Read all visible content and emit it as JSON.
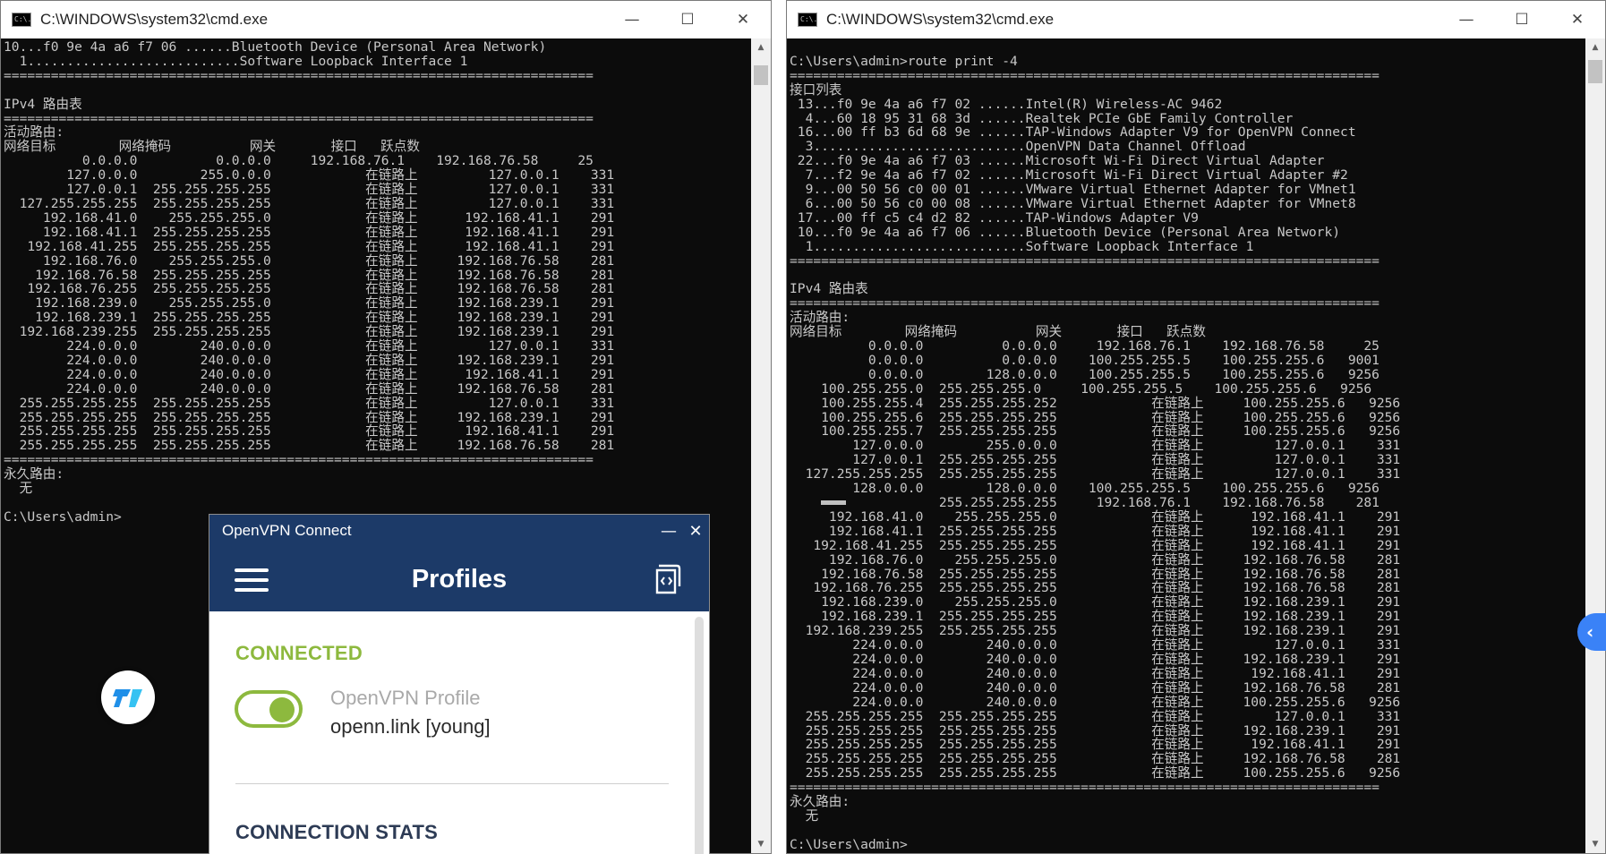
{
  "left_window": {
    "title": "C:\\WINDOWS\\system32\\cmd.exe",
    "icon": "C:\\.",
    "controls": {
      "minimize": "—",
      "maximize": "☐",
      "close": "✕"
    },
    "console_lines": [
      "10...f0 9e 4a a6 f7 06 ......Bluetooth Device (Personal Area Network)",
      "  1...........................Software Loopback Interface 1",
      "===========================================================================",
      "",
      "IPv4 路由表",
      "===========================================================================",
      "活动路由:",
      "网络目标        网络掩码          网关       接口   跃点数",
      "          0.0.0.0          0.0.0.0     192.168.76.1    192.168.76.58     25",
      "        127.0.0.0        255.0.0.0            在链路上         127.0.0.1    331",
      "        127.0.0.1  255.255.255.255            在链路上         127.0.0.1    331",
      "  127.255.255.255  255.255.255.255            在链路上         127.0.0.1    331",
      "     192.168.41.0    255.255.255.0            在链路上      192.168.41.1    291",
      "     192.168.41.1  255.255.255.255            在链路上      192.168.41.1    291",
      "   192.168.41.255  255.255.255.255            在链路上      192.168.41.1    291",
      "     192.168.76.0    255.255.255.0            在链路上     192.168.76.58    281",
      "    192.168.76.58  255.255.255.255            在链路上     192.168.76.58    281",
      "   192.168.76.255  255.255.255.255            在链路上     192.168.76.58    281",
      "    192.168.239.0    255.255.255.0            在链路上     192.168.239.1    291",
      "    192.168.239.1  255.255.255.255            在链路上     192.168.239.1    291",
      "  192.168.239.255  255.255.255.255            在链路上     192.168.239.1    291",
      "        224.0.0.0        240.0.0.0            在链路上         127.0.0.1    331",
      "        224.0.0.0        240.0.0.0            在链路上     192.168.239.1    291",
      "        224.0.0.0        240.0.0.0            在链路上      192.168.41.1    291",
      "        224.0.0.0        240.0.0.0            在链路上     192.168.76.58    281",
      "  255.255.255.255  255.255.255.255            在链路上         127.0.0.1    331",
      "  255.255.255.255  255.255.255.255            在链路上     192.168.239.1    291",
      "  255.255.255.255  255.255.255.255            在链路上      192.168.41.1    291",
      "  255.255.255.255  255.255.255.255            在链路上     192.168.76.58    281",
      "===========================================================================",
      "永久路由:",
      "  无",
      "",
      "C:\\Users\\admin>"
    ]
  },
  "right_window": {
    "title": "C:\\WINDOWS\\system32\\cmd.exe",
    "icon": "C:\\.",
    "controls": {
      "minimize": "—",
      "maximize": "☐",
      "close": "✕"
    },
    "console_lines": [
      "",
      "C:\\Users\\admin>route print -4",
      "===========================================================================",
      "接口列表",
      " 13...f0 9e 4a a6 f7 02 ......Intel(R) Wireless-AC 9462",
      "  4...60 18 95 31 68 3d ......Realtek PCIe GbE Family Controller",
      " 16...00 ff b3 6d 68 9e ......TAP-Windows Adapter V9 for OpenVPN Connect",
      "  3...........................OpenVPN Data Channel Offload",
      " 22...f0 9e 4a a6 f7 03 ......Microsoft Wi-Fi Direct Virtual Adapter",
      "  7...f2 9e 4a a6 f7 02 ......Microsoft Wi-Fi Direct Virtual Adapter #2",
      "  9...00 50 56 c0 00 01 ......VMware Virtual Ethernet Adapter for VMnet1",
      "  6...00 50 56 c0 00 08 ......VMware Virtual Ethernet Adapter for VMnet8",
      " 17...00 ff c5 c4 d2 82 ......TAP-Windows Adapter V9",
      " 10...f0 9e 4a a6 f7 06 ......Bluetooth Device (Personal Area Network)",
      "  1...........................Software Loopback Interface 1",
      "===========================================================================",
      "",
      "IPv4 路由表",
      "===========================================================================",
      "活动路由:",
      "网络目标        网络掩码          网关       接口   跃点数",
      "          0.0.0.0          0.0.0.0     192.168.76.1    192.168.76.58     25",
      "          0.0.0.0          0.0.0.0    100.255.255.5    100.255.255.6   9001",
      "          0.0.0.0        128.0.0.0    100.255.255.5    100.255.255.6   9256",
      "    100.255.255.0  255.255.255.0     100.255.255.5    100.255.255.6   9256",
      "    100.255.255.4  255.255.255.252            在链路上     100.255.255.6   9256",
      "    100.255.255.6  255.255.255.255            在链路上     100.255.255.6   9256",
      "    100.255.255.7  255.255.255.255            在链路上     100.255.255.6   9256",
      "        127.0.0.0        255.0.0.0            在链路上         127.0.0.1    331",
      "        127.0.0.1  255.255.255.255            在链路上         127.0.0.1    331",
      "  127.255.255.255  255.255.255.255            在链路上         127.0.0.1    331",
      "        128.0.0.0        128.0.0.0    100.255.255.5    100.255.255.6   9256",
      "                   255.255.255.255     192.168.76.1    192.168.76.58    281",
      "     192.168.41.0    255.255.255.0            在链路上      192.168.41.1    291",
      "     192.168.41.1  255.255.255.255            在链路上      192.168.41.1    291",
      "   192.168.41.255  255.255.255.255            在链路上      192.168.41.1    291",
      "     192.168.76.0    255.255.255.0            在链路上     192.168.76.58    281",
      "    192.168.76.58  255.255.255.255            在链路上     192.168.76.58    281",
      "   192.168.76.255  255.255.255.255            在链路上     192.168.76.58    281",
      "    192.168.239.0    255.255.255.0            在链路上     192.168.239.1    291",
      "    192.168.239.1  255.255.255.255            在链路上     192.168.239.1    291",
      "  192.168.239.255  255.255.255.255            在链路上     192.168.239.1    291",
      "        224.0.0.0        240.0.0.0            在链路上         127.0.0.1    331",
      "        224.0.0.0        240.0.0.0            在链路上     192.168.239.1    291",
      "        224.0.0.0        240.0.0.0            在链路上      192.168.41.1    291",
      "        224.0.0.0        240.0.0.0            在链路上     192.168.76.58    281",
      "        224.0.0.0        240.0.0.0            在链路上     100.255.255.6   9256",
      "  255.255.255.255  255.255.255.255            在链路上         127.0.0.1    331",
      "  255.255.255.255  255.255.255.255            在链路上     192.168.239.1    291",
      "  255.255.255.255  255.255.255.255            在链路上      192.168.41.1    291",
      "  255.255.255.255  255.255.255.255            在链路上     192.168.76.58    281",
      "  255.255.255.255  255.255.255.255            在链路上     100.255.255.6   9256",
      "===========================================================================",
      "永久路由:",
      "  无",
      "",
      "C:\\Users\\admin>"
    ]
  },
  "openvpn": {
    "window_title": "OpenVPN Connect",
    "controls": {
      "minimize": "—",
      "close": "✕"
    },
    "header_title": "Profiles",
    "status": "CONNECTED",
    "profile": {
      "name": "OpenVPN Profile",
      "server": "openn.link [young]",
      "connected": true
    },
    "stats_title": "CONNECTION STATS",
    "accent_color": "#8db93e",
    "header_color": "#1c3a68"
  },
  "widgets": {
    "side_tab_glyph": "‹"
  }
}
